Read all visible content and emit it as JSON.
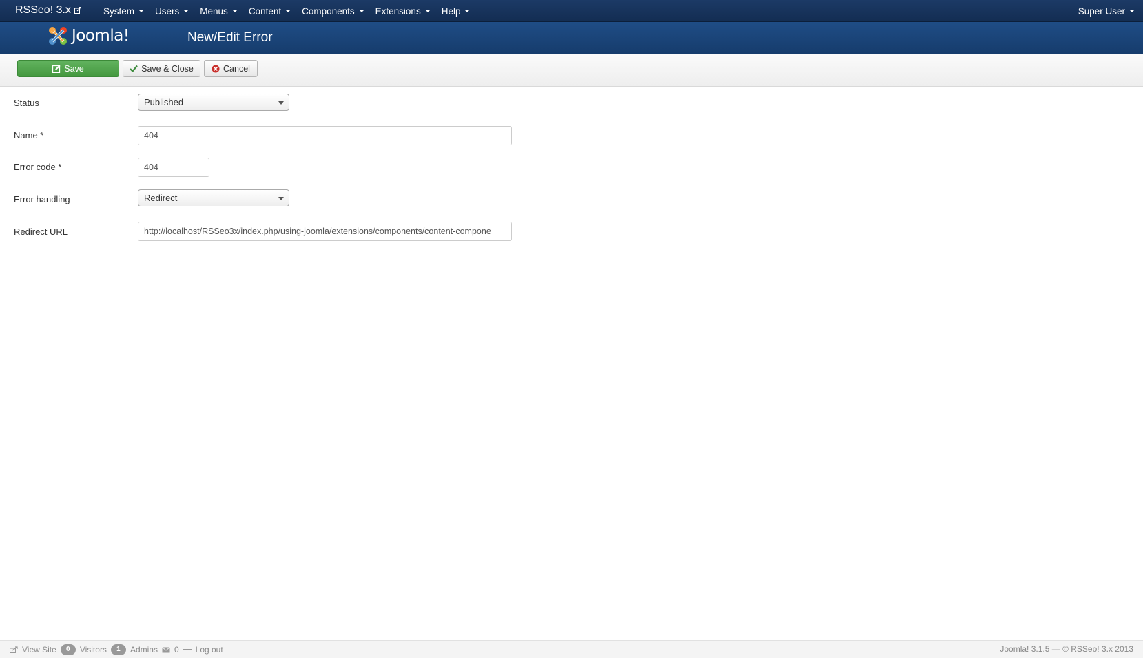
{
  "nav": {
    "brand": "RSSeo! 3.x",
    "items": [
      {
        "label": "System"
      },
      {
        "label": "Users"
      },
      {
        "label": "Menus"
      },
      {
        "label": "Content"
      },
      {
        "label": "Components"
      },
      {
        "label": "Extensions"
      },
      {
        "label": "Help"
      }
    ],
    "user": "Super User"
  },
  "header": {
    "logo_text": "Joomla!",
    "title": "New/Edit Error"
  },
  "toolbar": {
    "save_label": "Save",
    "save_close_label": "Save & Close",
    "cancel_label": "Cancel"
  },
  "form": {
    "status": {
      "label": "Status",
      "value": "Published"
    },
    "name": {
      "label": "Name *",
      "value": "404"
    },
    "error_code": {
      "label": "Error code *",
      "value": "404"
    },
    "error_handling": {
      "label": "Error handling",
      "value": "Redirect"
    },
    "redirect_url": {
      "label": "Redirect URL",
      "value": "http://localhost/RSSeo3x/index.php/using-joomla/extensions/components/content-compone"
    }
  },
  "statusbar": {
    "view_site": "View Site",
    "visitors_count": "0",
    "visitors_label": "Visitors",
    "admins_count": "1",
    "admins_label": "Admins",
    "messages_count": "0",
    "logout": "Log out",
    "version": "Joomla! 3.1.5 — © RSSeo! 3.x 2013"
  },
  "colors": {
    "navbar": "#1c3a66",
    "header": "#1f4d86",
    "save_button": "#51a84d"
  }
}
